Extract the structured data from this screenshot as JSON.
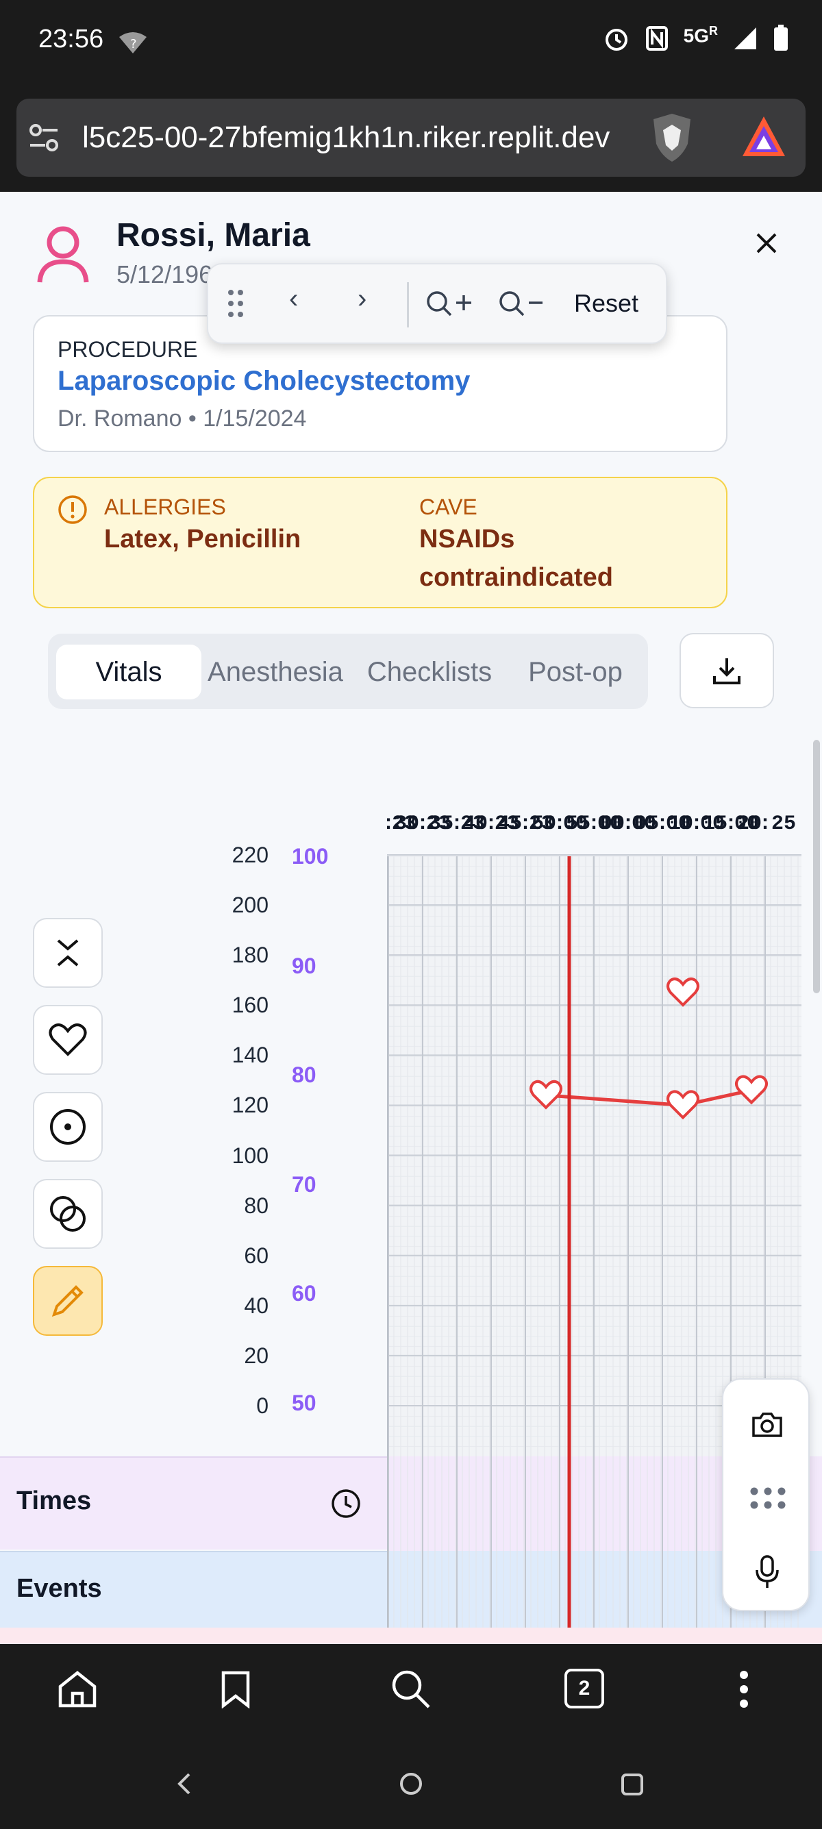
{
  "status_bar": {
    "time": "23:56",
    "network": "5G",
    "network_sup": "R"
  },
  "browser": {
    "url": "l5c25-00-27bfemig1kh1n.riker.replit.dev",
    "tab_count": "2"
  },
  "patient": {
    "name": "Rossi, Maria",
    "dob": "5/12/196"
  },
  "zoom_toolbar": {
    "prev": "‹",
    "next": "›",
    "zoom_in": "Q+",
    "zoom_out": "Q−",
    "reset": "Reset"
  },
  "procedure": {
    "label": "PROCEDURE",
    "name": "Laparoscopic Cholecystectomy",
    "meta": "Dr. Romano • 1/15/2024"
  },
  "allergies": {
    "label": "ALLERGIES",
    "value": "Latex, Penicillin",
    "cave_label": "CAVE",
    "cave_value_line1": "NSAIDs",
    "cave_value_line2": "contraindicated"
  },
  "tabs": [
    "Vitals",
    "Anesthesia",
    "Checklists",
    "Post-op"
  ],
  "chart": {
    "time_ticks": [
      "23:30",
      "23:35",
      "23:40",
      "23:45",
      "23:50",
      "23:55",
      "00:00",
      "00:05",
      "00:10",
      "00:15",
      "00:20",
      "00:25"
    ],
    "left_axis": [
      "220",
      "200",
      "180",
      "160",
      "140",
      "120",
      "100",
      "80",
      "60",
      "40",
      "20",
      "0"
    ],
    "right_axis": [
      "100",
      "90",
      "80",
      "70",
      "60",
      "50"
    ]
  },
  "chart_data": {
    "type": "line",
    "x_label_unit": "time",
    "series": [
      {
        "marker": "heart",
        "points": [
          {
            "x": "23:53",
            "y": 124
          },
          {
            "x": "00:13",
            "y": 120
          },
          {
            "x": "00:23",
            "y": 126
          }
        ]
      }
    ],
    "extra_points": [
      {
        "x": "00:13",
        "y": 165
      }
    ],
    "current_time": "23:56",
    "left_ylim": [
      0,
      220
    ],
    "right_ylim": [
      50,
      100
    ],
    "colors": {
      "line": "#e53e3e",
      "now_line": "#d62828",
      "right_axis": "#8b5cf6"
    }
  },
  "rows": {
    "times": "Times",
    "events": "Events"
  },
  "colors": {
    "link": "#2f6fd0",
    "allergy_text": "#7c2d12",
    "allergy_label": "#b45309",
    "pink": "#e84e8a"
  }
}
